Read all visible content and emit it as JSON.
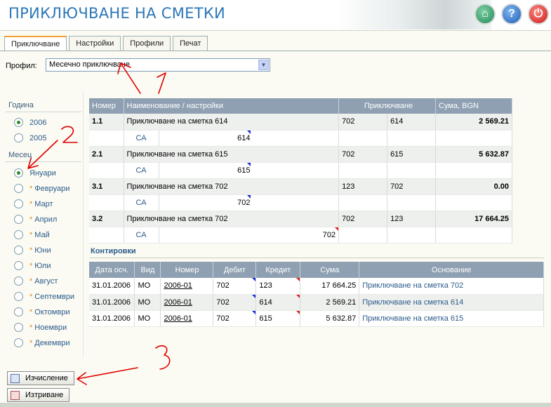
{
  "header": {
    "title": "ПРИКЛЮЧВАНЕ НА СМЕТКИ",
    "icons": [
      "home-icon",
      "help-icon",
      "power-icon"
    ]
  },
  "tabs": [
    "Приключване",
    "Настройки",
    "Профили",
    "Печат"
  ],
  "profile": {
    "label": "Профил:",
    "value": "Месечно приключване"
  },
  "year": {
    "title": "Година",
    "items": [
      "2006",
      "2005"
    ],
    "selected": "2006"
  },
  "month": {
    "title": "Месец",
    "items": [
      "Януари",
      "Февруари",
      "Март",
      "Април",
      "Май",
      "Юни",
      "Юли",
      "Август",
      "Септември",
      "Октомври",
      "Ноември",
      "Декември"
    ],
    "starred": [
      "Февруари",
      "Март",
      "Април",
      "Май",
      "Юни",
      "Юли",
      "Август",
      "Септември",
      "Октомври",
      "Ноември",
      "Декември"
    ],
    "selected": "Януари"
  },
  "main_table": {
    "headers": [
      "Номер",
      "Наименование / настройки",
      "Приключване",
      "Сума, BGN"
    ],
    "rows": [
      {
        "num": "1.1",
        "name": "Приключване на сметка 614",
        "a": "702",
        "b": "614",
        "sum": "2 569.21",
        "sub_label": "СА",
        "sub_val": "614"
      },
      {
        "num": "2.1",
        "name": "Приключване на сметка 615",
        "a": "702",
        "b": "615",
        "sum": "5 632.87",
        "sub_label": "СА",
        "sub_val": "615"
      },
      {
        "num": "3.1",
        "name": "Приключване на сметка 702",
        "a": "123",
        "b": "702",
        "sum": "0.00",
        "sub_label": "СА",
        "sub_val": "702"
      },
      {
        "num": "3.2",
        "name": "Приключване на сметка 702",
        "a": "702",
        "b": "123",
        "sum": "17 664.25",
        "sub_label": "СА",
        "sub_val": "702"
      }
    ]
  },
  "kontirovki": {
    "title": "Контировки",
    "headers": [
      "Дата осч.",
      "Вид",
      "Номер",
      "Дебит",
      "Кредит",
      "Сума",
      "Основание"
    ],
    "rows": [
      [
        "31.01.2006",
        "МО",
        "2006-01",
        "702",
        "123",
        "17 664.25",
        "Приключване на сметка 702"
      ],
      [
        "31.01.2006",
        "МО",
        "2006-01",
        "702",
        "614",
        "2 569.21",
        "Приключване на сметка 614"
      ],
      [
        "31.01.2006",
        "МО",
        "2006-01",
        "702",
        "615",
        "5 632.87",
        "Приключване на сметка 615"
      ]
    ]
  },
  "buttons": {
    "calc": "Изчисление",
    "delete": "Изтриване"
  },
  "annotations": {
    "one": "1",
    "two": "2",
    "three": "3",
    "color": "#e00000"
  }
}
